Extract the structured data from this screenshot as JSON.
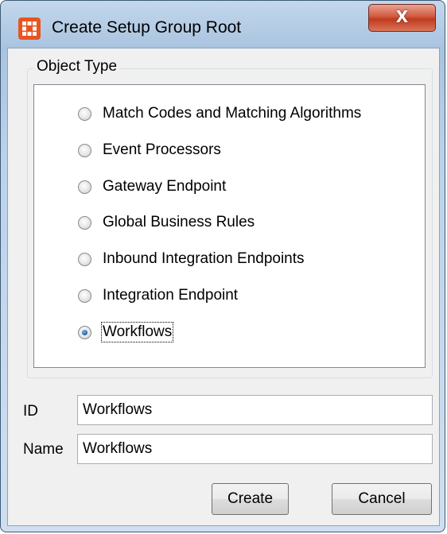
{
  "window": {
    "title": "Create Setup Group Root",
    "close_label": "X"
  },
  "icons": {
    "app": "app-grid-icon",
    "close": "close-icon"
  },
  "object_type": {
    "legend": "Object Type",
    "options": [
      {
        "label": "Match Codes and Matching Algorithms",
        "checked": false
      },
      {
        "label": "Event Processors",
        "checked": false
      },
      {
        "label": "Gateway Endpoint",
        "checked": false
      },
      {
        "label": "Global Business Rules",
        "checked": false
      },
      {
        "label": "Inbound Integration Endpoints",
        "checked": false
      },
      {
        "label": "Integration Endpoint",
        "checked": false
      },
      {
        "label": "Workflows",
        "checked": true
      }
    ]
  },
  "fields": {
    "id_label": "ID",
    "id_value": "Workflows",
    "name_label": "Name",
    "name_value": "Workflows"
  },
  "buttons": {
    "create": "Create",
    "cancel": "Cancel"
  },
  "colors": {
    "app_icon": "#e8541e",
    "close_button": "#c7432a",
    "selected_radio": "#1d5fa8"
  }
}
